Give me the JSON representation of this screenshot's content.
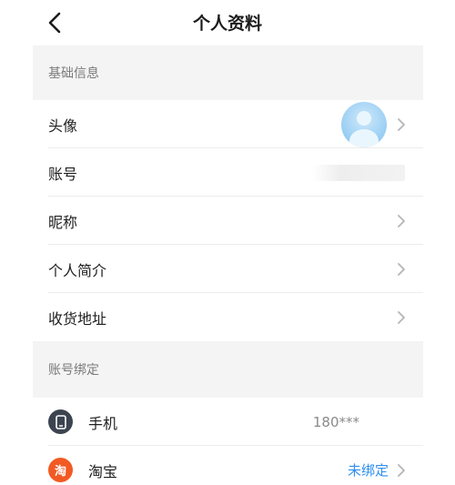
{
  "header": {
    "title": "个人资料"
  },
  "sections": {
    "basic": {
      "label": "基础信息",
      "avatar_label": "头像",
      "account_label": "账号",
      "nickname_label": "昵称",
      "bio_label": "个人简介",
      "address_label": "收货地址"
    },
    "binding": {
      "label": "账号绑定",
      "phone": {
        "label": "手机",
        "value": "180***"
      },
      "taobao": {
        "label": "淘宝",
        "icon_text": "淘",
        "status": "未绑定"
      }
    }
  },
  "colors": {
    "link": "#2f8ff0",
    "section_bg": "#f4f4f4",
    "taobao": "#f25a24",
    "phone_icon": "#3d4450"
  },
  "icons": {
    "back": "chevron-left-icon",
    "row_arrow": "chevron-right-icon",
    "phone": "phone-icon",
    "taobao": "taobao-icon"
  }
}
